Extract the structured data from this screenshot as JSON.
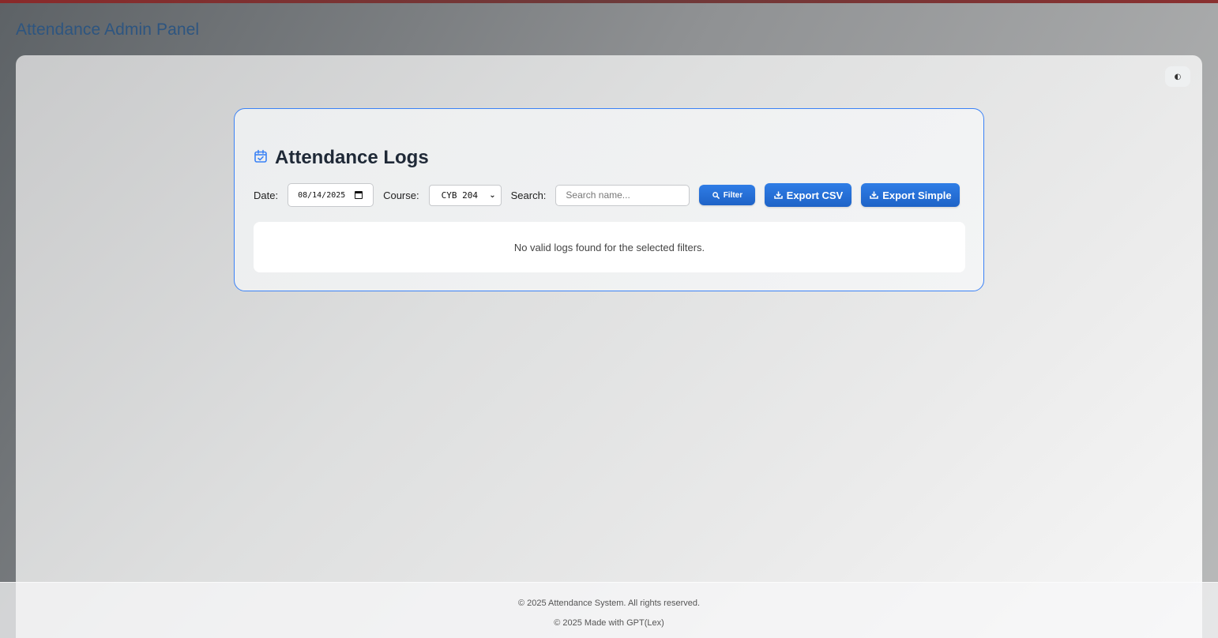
{
  "app": {
    "title": "Attendance Admin Panel"
  },
  "theme_toggle": {
    "icon": "palette-icon",
    "glyph": "◐"
  },
  "logs": {
    "title": "Attendance Logs",
    "title_icon": "calendar-check-icon",
    "accent_color": "#3b82f6"
  },
  "filters": {
    "date_label": "Date:",
    "date_value": "08/14/2025",
    "course_label": "Course:",
    "course_value": "CYB 204",
    "search_label": "Search:",
    "search_placeholder": "Search name...",
    "search_value": "",
    "filter_button": "Filter",
    "export_csv_button": "Export CSV",
    "export_simple_button": "Export Simple",
    "button_color": "#1e63c7"
  },
  "results": {
    "empty_message": "No valid logs found for the selected filters."
  },
  "footer": {
    "line1": "© 2025 Attendance System. All rights reserved.",
    "line2": "© 2025 Made with GPT(Lex)"
  }
}
